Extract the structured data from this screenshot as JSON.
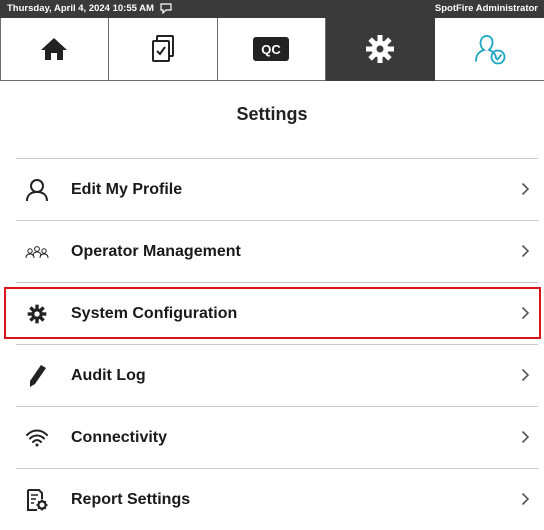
{
  "status_bar": {
    "datetime": "Thursday, April 4, 2024 10:55 AM",
    "user": "SpotFire Administrator"
  },
  "nav": {
    "tabs": [
      {
        "name": "home",
        "icon": "home-icon"
      },
      {
        "name": "checklist",
        "icon": "checklist-icon"
      },
      {
        "name": "qc",
        "icon": "qc-icon",
        "label": "QC"
      },
      {
        "name": "settings",
        "icon": "gear-icon",
        "active": true
      },
      {
        "name": "operator",
        "icon": "operator-check-icon"
      }
    ]
  },
  "page": {
    "title": "Settings"
  },
  "settings_items": [
    {
      "label": "Edit My Profile",
      "icon": "person-icon"
    },
    {
      "label": "Operator Management",
      "icon": "people-icon"
    },
    {
      "label": "System Configuration",
      "icon": "gear-icon",
      "highlighted": true
    },
    {
      "label": "Audit Log",
      "icon": "pen-icon"
    },
    {
      "label": "Connectivity",
      "icon": "wifi-icon"
    },
    {
      "label": "Report Settings",
      "icon": "report-settings-icon"
    }
  ],
  "colors": {
    "header_bg": "#3a3a3a",
    "highlight": "#d9141a",
    "accent_teal": "#1aa6c4"
  }
}
